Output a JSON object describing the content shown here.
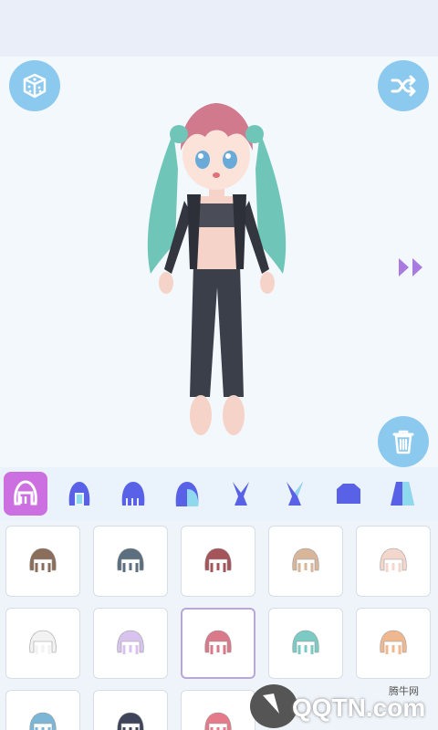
{
  "app": {
    "accent": "#8cc9ee",
    "tab_active_color": "#cc6fe0"
  },
  "stage": {
    "random_button_icon": "dice-icon",
    "shuffle_button_icon": "shuffle-icon",
    "next_icon": "double-chevron-right-icon",
    "delete_button_icon": "trash-icon"
  },
  "tabs": [
    {
      "icon": "hair-front-icon",
      "active": true
    },
    {
      "icon": "hair-side-icon",
      "active": false
    },
    {
      "icon": "hair-back-icon",
      "active": false
    },
    {
      "icon": "hair-long-icon",
      "active": false
    },
    {
      "icon": "bunny-ears-icon",
      "active": false
    },
    {
      "icon": "bunny-ears-alt-icon",
      "active": false
    },
    {
      "icon": "top-shirt-icon",
      "active": false
    },
    {
      "icon": "dress-icon",
      "active": false
    }
  ],
  "hair_items": [
    {
      "color": "#8a6d5a",
      "selected": false
    },
    {
      "color": "#5c6f80",
      "selected": false
    },
    {
      "color": "#a5545a",
      "selected": false
    },
    {
      "color": "#d8b69a",
      "selected": false
    },
    {
      "color": "#f3d7cc",
      "selected": false
    },
    {
      "color": "#f2f2f2",
      "selected": false
    },
    {
      "color": "#d8c3ee",
      "selected": false
    },
    {
      "color": "#d9798a",
      "selected": true
    },
    {
      "color": "#7ccac4",
      "selected": false
    },
    {
      "color": "#f0b891",
      "selected": false
    },
    {
      "color": "#7cb6d6",
      "selected": false
    },
    {
      "color": "#40445a",
      "selected": false
    },
    {
      "color": "#e57a8a",
      "selected": false
    }
  ],
  "watermark": {
    "text": "QQTN.com",
    "small": "腾牛网"
  }
}
